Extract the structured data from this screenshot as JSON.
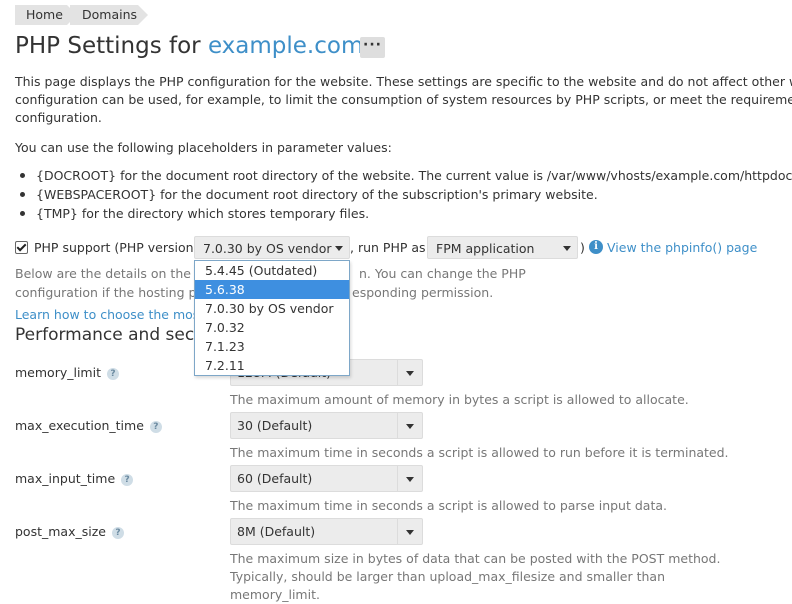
{
  "breadcrumb": [
    "Home",
    "Domains"
  ],
  "title": {
    "prefix": "PHP Settings for ",
    "domain": "example.com"
  },
  "more_label": "···",
  "intro": [
    "This page displays the PHP configuration for the website. These settings are specific to the website and do not affect other websi",
    "configuration can be used, for example, to limit the consumption of system resources by PHP scripts, or meet the requirements o",
    "configuration."
  ],
  "placeholders_intro": "You can use the following placeholders in parameter values:",
  "placeholders": [
    "{DOCROOT} for the document root directory of the website. The current value is /var/www/vhosts/example.com/httpdocs. Th",
    "{WEBSPACEROOT} for the document root directory of the subscription's primary website.",
    "{TMP} for the directory which stores temporary files."
  ],
  "php_support": {
    "checked": true,
    "label": "PHP support (PHP version",
    "version_value": "7.0.30 by OS vendor",
    "run_label": ", run PHP as",
    "handler_value": "FPM application",
    "close_paren": ")",
    "phpinfo_link": "View the phpinfo() page",
    "info_icon": "info-icon"
  },
  "details": [
    "Below are the details on the w",
    "n. You can change the PHP",
    "configuration if the hosting pr",
    "esponding permission."
  ],
  "learn_link": "Learn how to choose the mos",
  "section_title": "Performance and securi",
  "version_options": [
    "5.4.45 (Outdated)",
    "5.6.38",
    "7.0.30 by OS vendor",
    "7.0.32",
    "7.1.23",
    "7.2.11"
  ],
  "version_highlighted": "5.6.38",
  "settings": [
    {
      "name": "memory_limit",
      "value": "128M (Default)",
      "desc": [
        "The maximum amount of memory in bytes a script is allowed to allocate."
      ]
    },
    {
      "name": "max_execution_time",
      "value": "30 (Default)",
      "desc": [
        "The maximum time in seconds a script is allowed to run before it is terminated."
      ]
    },
    {
      "name": "max_input_time",
      "value": "60 (Default)",
      "desc": [
        "The maximum time in seconds a script is allowed to parse input data."
      ]
    },
    {
      "name": "post_max_size",
      "value": "8M (Default)",
      "desc": [
        "The maximum size in bytes of data that can be posted with the POST method.",
        "Typically, should be larger than upload_max_filesize and smaller than",
        "memory_limit."
      ]
    }
  ],
  "help_glyph": "?",
  "colors": {
    "link": "#3e8fc8",
    "highlight": "#3e8fe0",
    "field_bg": "#ececec",
    "muted_text": "#777777"
  }
}
